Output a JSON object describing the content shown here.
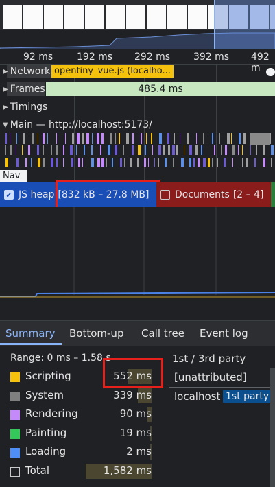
{
  "ruler": {
    "ticks": [
      "92 ms",
      "192 ms",
      "292 ms",
      "392 ms",
      "492 m"
    ]
  },
  "tracks": {
    "network": {
      "label": "Network",
      "request": "opentiny_vue.js (localho..."
    },
    "frames": {
      "label": "Frames",
      "value": "485.4 ms"
    },
    "timings": {
      "label": "Timings"
    },
    "main": {
      "label": "Main — http://localhost:5173/"
    },
    "nav": {
      "label": "Nav"
    }
  },
  "counters": {
    "js_heap": {
      "label": "JS heap",
      "range": "[832 kB – 27.8 MB]",
      "checked": true,
      "color": "#1a4eb7"
    },
    "documents": {
      "label": "Documents",
      "range": "[2 – 4]",
      "checked": false,
      "color": "#8a1c1c"
    }
  },
  "tabs": [
    "Summary",
    "Bottom-up",
    "Call tree",
    "Event log"
  ],
  "summary": {
    "range": "Range: 0 ms – 1.58 s",
    "categories": [
      {
        "name": "Scripting",
        "value": "552 ms",
        "color": "#f4c20d",
        "fraction": 0.35
      },
      {
        "name": "System",
        "value": "339 ms",
        "color": "#7f7f7f",
        "fraction": 0.21
      },
      {
        "name": "Rendering",
        "value": "90 ms",
        "color": "#c58af9",
        "fraction": 0.06
      },
      {
        "name": "Painting",
        "value": "19 ms",
        "color": "#34c759",
        "fraction": 0.01
      },
      {
        "name": "Loading",
        "value": "2 ms",
        "color": "#4f8ef7",
        "fraction": 0.001
      },
      {
        "name": "Total",
        "value": "1,582 ms",
        "color": "",
        "fraction": 1.0
      }
    ]
  },
  "party": {
    "header": "1st / 3rd party",
    "unattributed": "[unattributed]",
    "localhost": "localhost",
    "badge": "1st party"
  }
}
